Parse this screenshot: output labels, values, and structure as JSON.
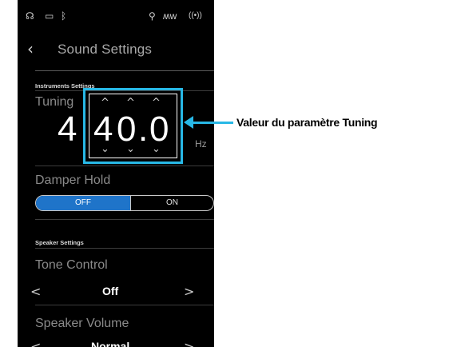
{
  "status_bar": {
    "icons": [
      "headphones-icon",
      "usb-icon",
      "bluetooth-icon",
      "microphone-icon",
      "audio-wave-icon",
      "wireless-icon"
    ],
    "glyphs": [
      "☊",
      "▭",
      "ᛒ",
      "⚲",
      "ʍᴡ",
      "((•))"
    ]
  },
  "header": {
    "back": "‹",
    "title": "Sound Settings"
  },
  "instruments_settings": {
    "section_label": "Instruments Settings",
    "tuning": {
      "label": "Tuning",
      "value": "440.0",
      "digits": [
        "4",
        "4",
        "0",
        ".",
        "0"
      ],
      "unit": "Hz",
      "up_arrow": "^",
      "down_arrow": "⌄"
    },
    "damper_hold": {
      "label": "Damper Hold",
      "off": "OFF",
      "on": "ON",
      "selected": "OFF"
    }
  },
  "speaker_settings": {
    "section_label": "Speaker Settings",
    "tone_control": {
      "label": "Tone Control",
      "value": "Off",
      "prev": "<",
      "next": ">"
    },
    "speaker_volume": {
      "label": "Speaker Volume",
      "value": "Normal",
      "prev": "<",
      "next": ">"
    }
  },
  "callout": {
    "text": "Valeur du paramètre Tuning",
    "color": "#28b8e6"
  },
  "colors": {
    "accent_blue": "#1f74c9",
    "highlight": "#28b8e6",
    "background": "#000000"
  }
}
